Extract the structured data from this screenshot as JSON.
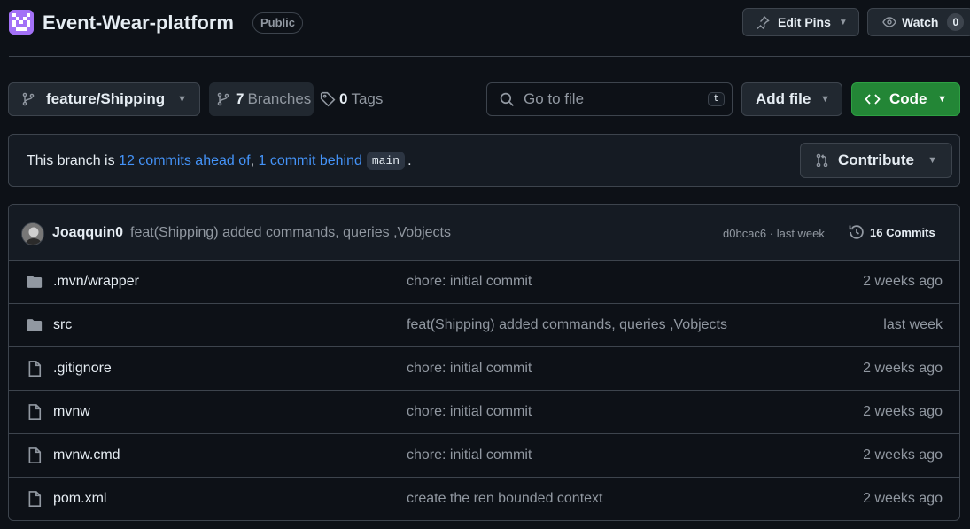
{
  "repo": {
    "name": "Event-Wear-platform",
    "visibility": "Public",
    "avatar_color": "#a371f7"
  },
  "header_actions": {
    "edit_pins_label": "Edit Pins",
    "watch_label": "Watch",
    "watch_count": "0"
  },
  "toolbar": {
    "branch": "feature/Shipping",
    "branches_count": "7",
    "branches_label": "Branches",
    "tags_count": "0",
    "tags_label": "Tags",
    "goto_placeholder": "Go to file",
    "goto_shortcut": "t",
    "add_file_label": "Add file",
    "code_label": "Code",
    "code_color": "#238636"
  },
  "banner": {
    "prefix": "This branch is",
    "ahead_text": "12 commits ahead of",
    "separator": ",",
    "behind_text": "1 commit behind",
    "base_branch": "main",
    "suffix": ".",
    "contribute_label": "Contribute"
  },
  "latest_commit": {
    "author": "Joaqquin0",
    "message": "feat(Shipping) added commands, queries ,Vobjects",
    "meta": "d0bcac6 · last week",
    "commits_label": "16 Commits"
  },
  "files": [
    {
      "icon": "folder-icon",
      "name": ".mvn/wrapper",
      "commit": "chore: initial commit",
      "date": "2 weeks ago"
    },
    {
      "icon": "folder-icon",
      "name": "src",
      "commit": "feat(Shipping) added commands, queries ,Vobjects",
      "date": "last week"
    },
    {
      "icon": "file-icon",
      "name": ".gitignore",
      "commit": "chore: initial commit",
      "date": "2 weeks ago"
    },
    {
      "icon": "file-icon",
      "name": "mvnw",
      "commit": "chore: initial commit",
      "date": "2 weeks ago"
    },
    {
      "icon": "file-icon",
      "name": "mvnw.cmd",
      "commit": "chore: initial commit",
      "date": "2 weeks ago"
    },
    {
      "icon": "file-icon",
      "name": "pom.xml",
      "commit": "create the ren bounded context",
      "date": "2 weeks ago"
    }
  ]
}
